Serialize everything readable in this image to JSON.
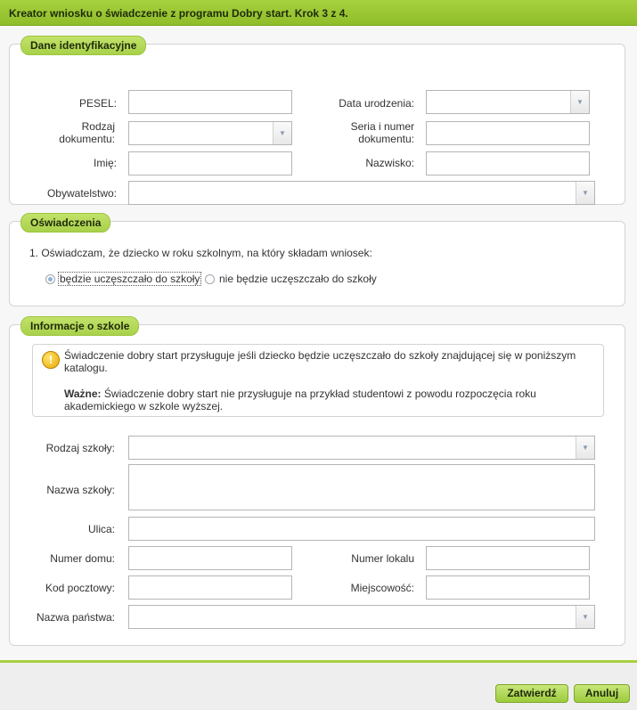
{
  "title": "Kreator wniosku o świadczenie z programu Dobry start. Krok 3 z 4.",
  "identity": {
    "legend": "Dane identyfikacyjne",
    "pesel_label": "PESEL:",
    "birthdate_label": "Data urodzenia:",
    "doctype_label": "Rodzaj dokumentu:",
    "docnumber_label": "Seria i numer dokumentu:",
    "firstname_label": "Imię:",
    "lastname_label": "Nazwisko:",
    "citizenship_label": "Obywatelstwo:"
  },
  "declarations": {
    "legend": "Oświadczenia",
    "question": "1. Oświadczam, że dziecko w roku szkolnym, na który składam wniosek:",
    "option_yes": "będzie uczęszczało do szkoły",
    "option_no": "nie będzie uczęszczało do szkoły",
    "selected": "option_yes"
  },
  "school": {
    "legend": "Informacje o szkole",
    "info_text": "Świadczenie dobry start przysługuje jeśli dziecko będzie uczęszczało do szkoły znajdującej się w poniższym katalogu.",
    "important_label": "Ważne:",
    "important_text": "Świadczenie dobry start nie przysługuje na przykład studentowi z powodu rozpoczęcia roku akademickiego w szkole wyższej.",
    "type_label": "Rodzaj szkoły:",
    "name_label": "Nazwa szkoły:",
    "street_label": "Ulica:",
    "house_label": "Numer domu:",
    "flat_label": "Numer lokalu",
    "postcode_label": "Kod pocztowy:",
    "city_label": "Miejscowość:",
    "country_label": "Nazwa państwa:"
  },
  "buttons": {
    "confirm": "Zatwierdź",
    "cancel": "Anuluj"
  },
  "icons": {
    "dropdown": "chevron-down-icon",
    "info": "exclamation-warning-icon"
  },
  "colors": {
    "accent": "#a7d13f",
    "legend_bg": "#b5da5a"
  }
}
